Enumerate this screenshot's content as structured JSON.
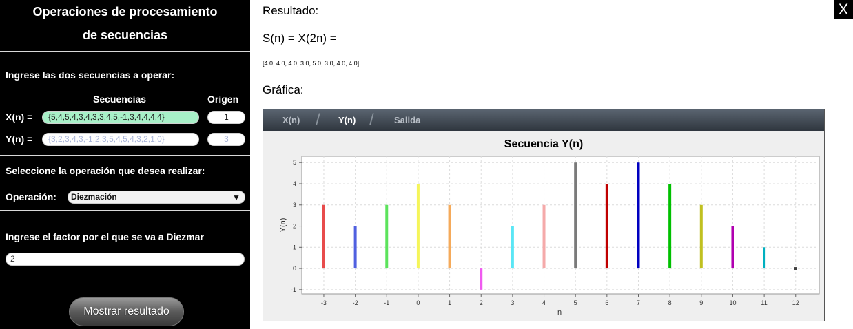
{
  "sidebar": {
    "title_line1": "Operaciones de procesamiento",
    "title_line2": "de secuencias",
    "input_prompt": "Ingrese las dos secuencias a operar:",
    "seq_header": "Secuencias",
    "origin_header": "Origen",
    "x_label": "X(n) =",
    "x_value": "{5,4,5,4,3,4,3,3,4,5,-1,3,4,4,4,4}",
    "x_origin": "1",
    "y_label": "Y(n) =",
    "y_placeholder": "{3,2,3,4,3,-1,2,3,5,4,5,4,3,2,1,0}",
    "y_origin_placeholder": "3",
    "op_prompt": "Seleccione la operación que desea realizar:",
    "op_label": "Operación:",
    "op_value": "Diezmación",
    "factor_prompt": "Ingrese el factor por el que se va a Diezmar",
    "factor_value": "2",
    "show_button": "Mostrar resultado"
  },
  "close_label": "X",
  "main": {
    "result_label": "Resultado:",
    "formula": "S(n) =  X(2n) =",
    "result_values": "[4.0, 4.0, 4.0, 3.0, 5.0, 3.0, 4.0, 4.0]",
    "graph_label": "Gráfica:"
  },
  "tabs": [
    {
      "label": "X(n)"
    },
    {
      "label": "Y(n)"
    },
    {
      "label": "Salida"
    }
  ],
  "chart_data": {
    "type": "bar",
    "title": "Secuencia Y(n)",
    "xlabel": "n",
    "ylabel": "Y(n)",
    "ylim": [
      -1.2,
      5.3
    ],
    "x_ticks": [
      "-3",
      "-2",
      "-1",
      "0",
      "1",
      "2",
      "3",
      "4",
      "5",
      "6",
      "7",
      "8",
      "9",
      "10",
      "11",
      "12"
    ],
    "y_ticks": [
      "-1",
      "0",
      "1",
      "2",
      "3",
      "4",
      "5"
    ],
    "grid": true,
    "series": [
      {
        "x": [
          -3,
          -2,
          -1,
          0,
          1,
          2,
          3,
          4,
          5,
          6,
          7,
          8,
          9,
          10,
          11,
          12
        ],
        "values": [
          3,
          2,
          3,
          4,
          3,
          -1,
          2,
          3,
          5,
          4,
          5,
          4,
          3,
          2,
          1,
          0
        ],
        "colors": [
          "#e84c4c",
          "#5060e0",
          "#5ce35c",
          "#f5f55a",
          "#f5aa5a",
          "#f05af0",
          "#5ae6f5",
          "#f5aaaa",
          "#7a7a7a",
          "#c00000",
          "#0000c0",
          "#00c000",
          "#c0c020",
          "#b000b0",
          "#00b0c0",
          "#404040"
        ]
      }
    ]
  }
}
